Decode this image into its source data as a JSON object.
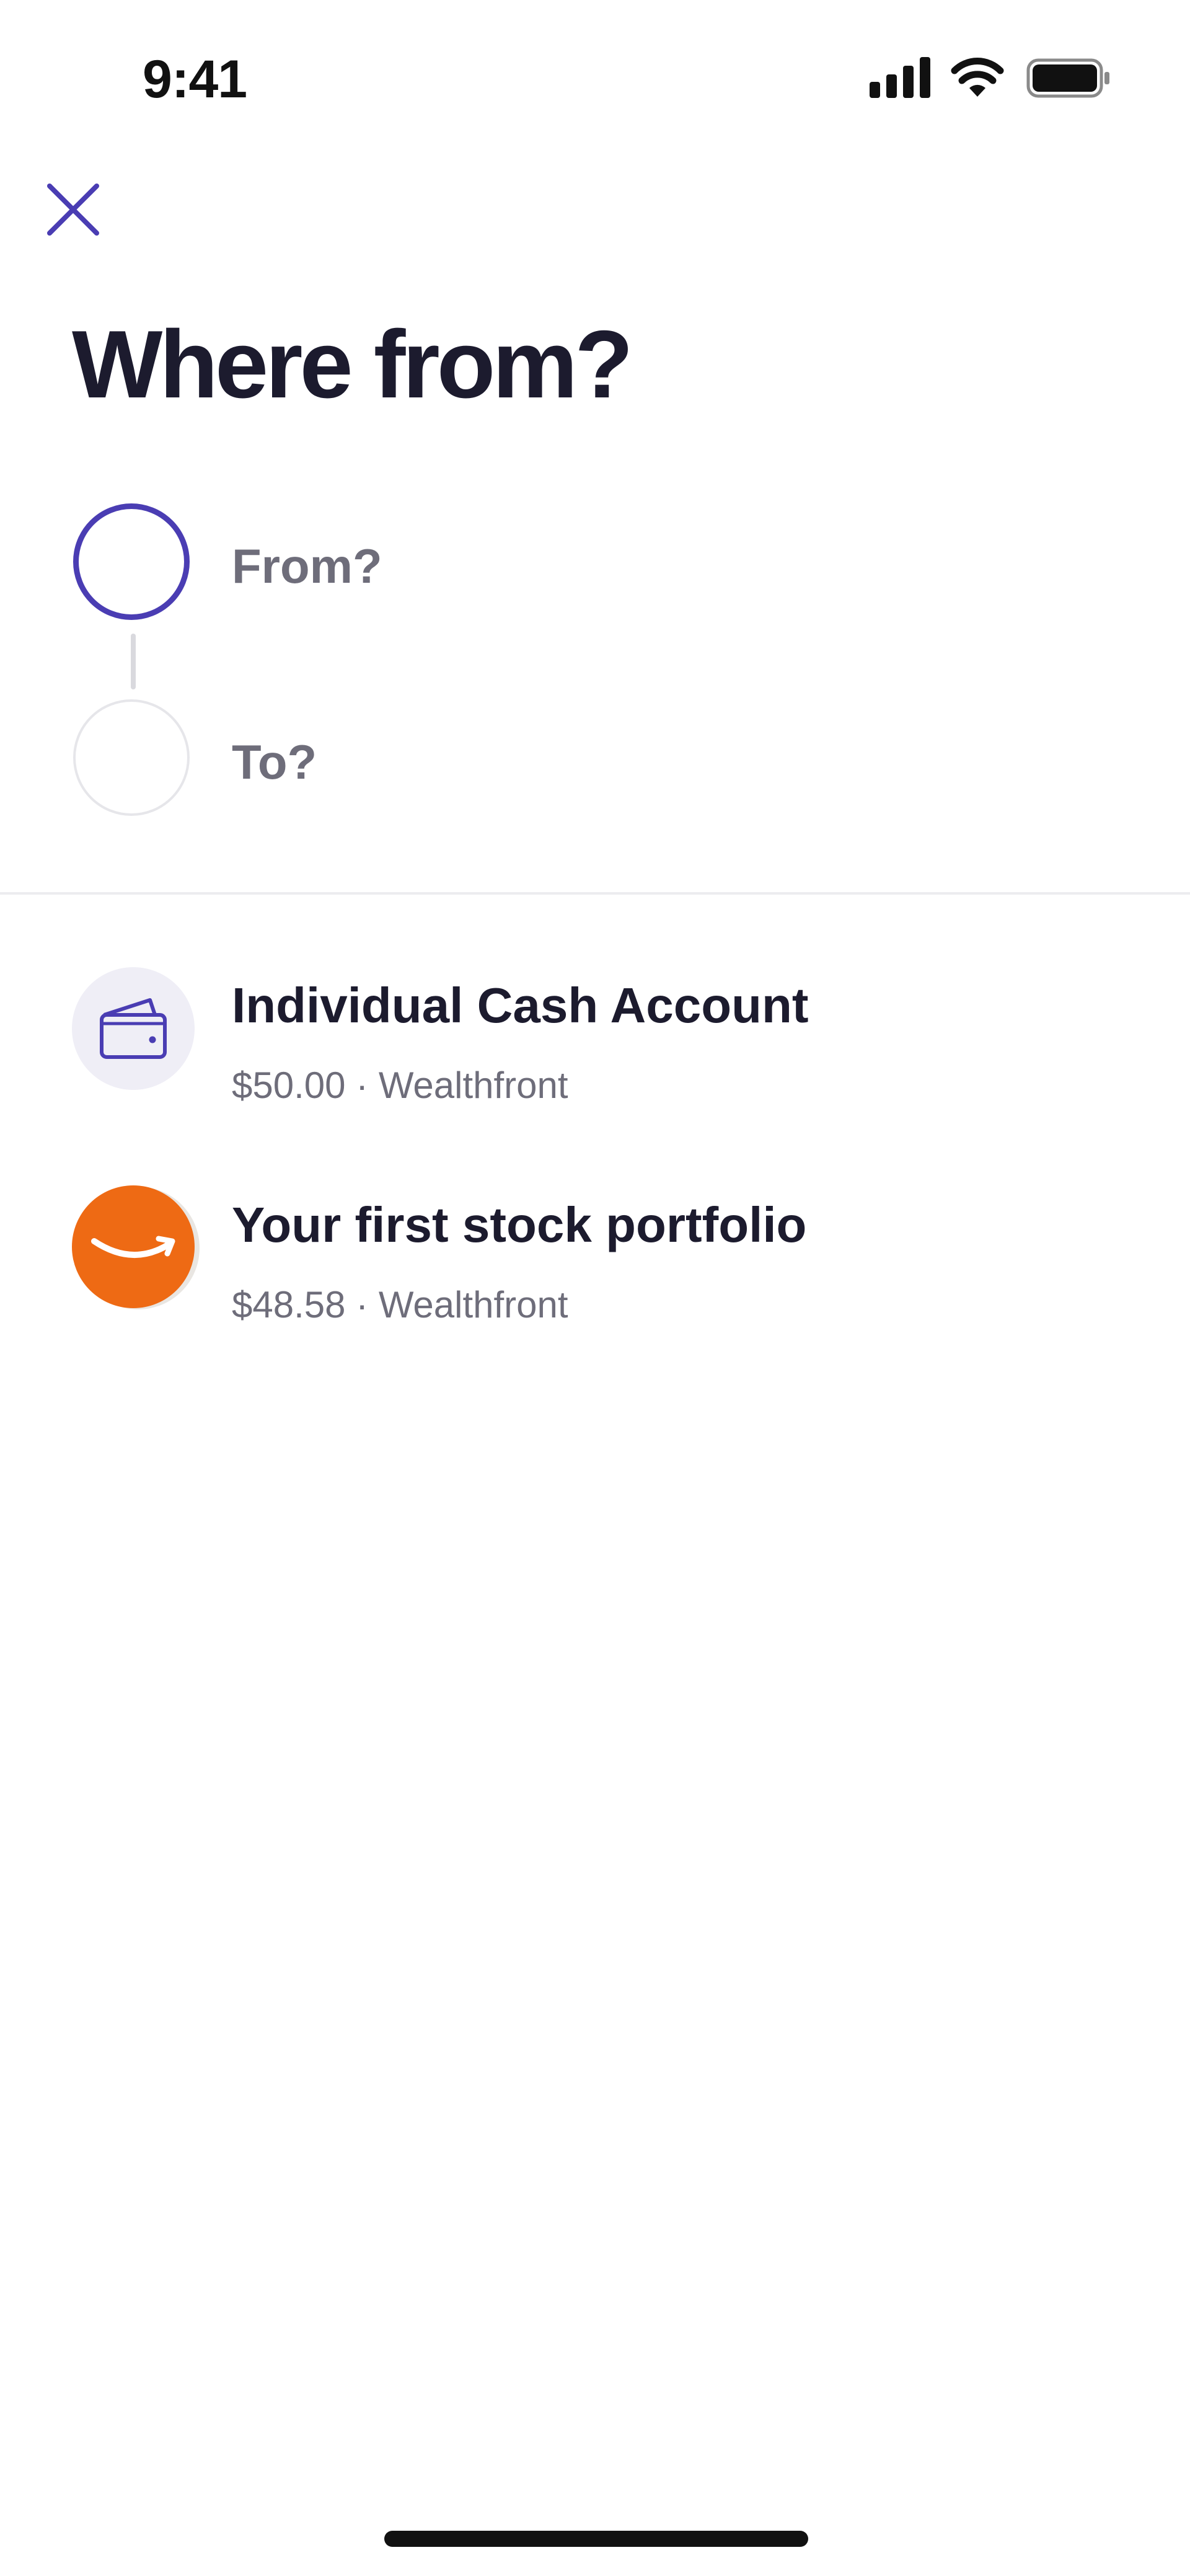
{
  "status_bar": {
    "time": "9:41",
    "icons": [
      "signal-icon",
      "wifi-icon",
      "battery-icon"
    ]
  },
  "header": {
    "close_icon": "close-icon",
    "title": "Where from?"
  },
  "stepper": {
    "from_label": "From?",
    "to_label": "To?"
  },
  "accounts": [
    {
      "name": "Individual Cash Account",
      "amount": "$50.00",
      "separator": "·",
      "provider": "Wealthfront",
      "subtitle": "$50.00 · Wealthfront",
      "icon": "wallet-icon"
    },
    {
      "name": "Your first stock portfolio",
      "amount": "$48.58",
      "separator": "·",
      "provider": "Wealthfront",
      "subtitle": "$48.58 · Wealthfront",
      "icon": "amazon-logo-icon"
    }
  ],
  "colors": {
    "accent": "#4a3db3",
    "title_text": "#1c1b2e",
    "secondary_text": "#6e6d7a",
    "amazon_orange": "#ee6a14"
  }
}
